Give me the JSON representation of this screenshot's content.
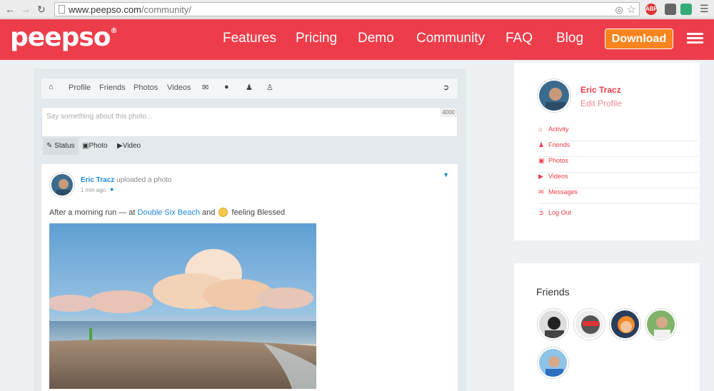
{
  "browser": {
    "url_host": "www.peepso.com",
    "url_path": "/community/",
    "abp_label": "ABP"
  },
  "header": {
    "logo": "peepso",
    "logo_mark": "®",
    "nav": [
      "Features",
      "Pricing",
      "Demo",
      "Community",
      "FAQ",
      "Blog"
    ],
    "download_label": "Download"
  },
  "subnav": {
    "items": [
      "Profile",
      "Friends",
      "Photos",
      "Videos"
    ],
    "icons": [
      "home-icon",
      "envelope-icon",
      "globe-icon",
      "user-icon",
      "user-plus-icon",
      "sign-out-icon"
    ]
  },
  "composer": {
    "placeholder": "Say something about this photo...",
    "counter": "4000",
    "tabs": [
      "Status",
      "Photo",
      "Video"
    ]
  },
  "post": {
    "author": "Eric Tracz",
    "action": "uploaded a photo",
    "time": "1 min ago",
    "text_before": "After a morning run — at",
    "location": "Double Six Beach",
    "text_and": "and",
    "feeling": "feeling Blessed"
  },
  "profile": {
    "name": "Eric Tracz",
    "edit_label": "Edit Profile",
    "links": [
      "Activity",
      "Friends",
      "Photos",
      "Videos",
      "Messages"
    ],
    "logout_label": "Log Out"
  },
  "friends": {
    "title": "Friends"
  },
  "colors": {
    "brand": "#ee3d4a",
    "download": "#f7841f",
    "link": "#1e88d9"
  }
}
